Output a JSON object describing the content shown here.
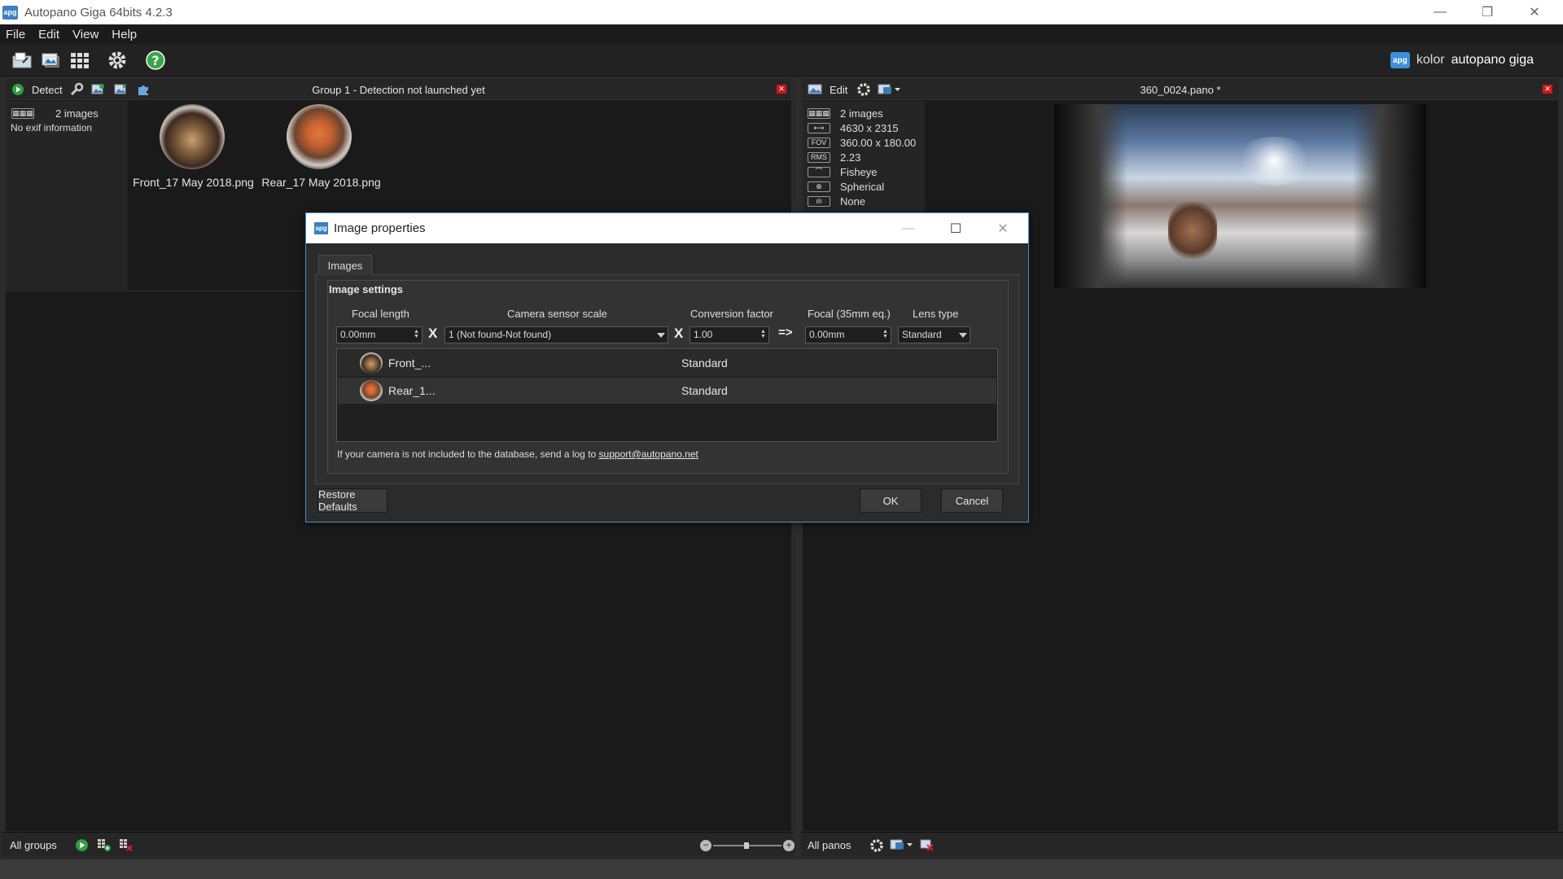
{
  "window": {
    "app_icon": "apg",
    "title": "Autopano Giga 64bits 4.2.3"
  },
  "menu": [
    "File",
    "Edit",
    "View",
    "Help"
  ],
  "brand": {
    "logo": "apg",
    "prefix": "kolor",
    "name": "autopano giga"
  },
  "left_panel": {
    "detect_label": "Detect",
    "group_title": "Group 1 - Detection not launched yet",
    "image_count": "2 images",
    "exif": "No exif information",
    "thumbnails": [
      "Front_17 May 2018.png",
      "Rear_17 May 2018.png"
    ],
    "footer_label": "All groups"
  },
  "right_panel": {
    "edit_label": "Edit",
    "pano_title": "360_0024.pano *",
    "info": [
      {
        "icon": "grid-icon",
        "tag": "▦▦▦",
        "value": "2 images"
      },
      {
        "icon": "size-arrow-icon",
        "tag": "⟷",
        "value": "4630 x 2315"
      },
      {
        "icon": "fov-icon",
        "tag": "FOV",
        "value": "360.00 x 180.00"
      },
      {
        "icon": "rms-icon",
        "tag": "RMS",
        "value": "2.23"
      },
      {
        "icon": "fisheye-icon",
        "tag": "⌒",
        "value": "Fisheye"
      },
      {
        "icon": "spherical-icon",
        "tag": "⊕",
        "value": "Spherical"
      },
      {
        "icon": "none-icon",
        "tag": "ılı",
        "value": "None"
      }
    ],
    "footer_label": "All panos"
  },
  "dialog": {
    "app_icon": "apg",
    "title": "Image properties",
    "tab": "Images",
    "group_label": "Image settings",
    "columns": {
      "focal_length": "Focal length",
      "sensor_scale": "Camera sensor scale",
      "conversion": "Conversion factor",
      "focal35": "Focal (35mm eq.)",
      "lens_type": "Lens type"
    },
    "fields": {
      "focal_length": "0.00mm",
      "sensor_scale": "1 (Not found-Not found)",
      "conversion": "1.00",
      "focal35": "0.00mm",
      "lens_type": "Standard"
    },
    "op_multiply": "X",
    "op_result": "=>",
    "rows": [
      {
        "name": "Front_...",
        "lens": "Standard"
      },
      {
        "name": "Rear_1...",
        "lens": "Standard"
      }
    ],
    "note_prefix": "If your camera is not included to the database, send a log to",
    "note_link": "support@autopano.net",
    "restore_label": "Restore Defaults",
    "ok_label": "OK",
    "cancel_label": "Cancel"
  }
}
